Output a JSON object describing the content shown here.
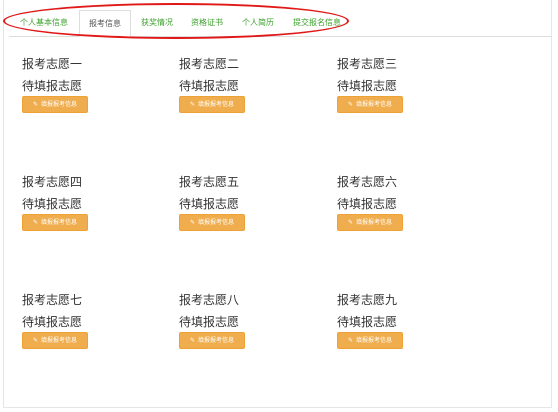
{
  "tabs": [
    {
      "label": "个人基本信息",
      "active": false
    },
    {
      "label": "报考信息",
      "active": true
    },
    {
      "label": "获奖情况",
      "active": false
    },
    {
      "label": "资格证书",
      "active": false
    },
    {
      "label": "个人简历",
      "active": false
    },
    {
      "label": "提交报名信息",
      "active": false
    }
  ],
  "colors": {
    "accent_green": "#3aa12b",
    "button_warning": "#f0ad4e",
    "annotation_red": "#e01818"
  },
  "choices": [
    {
      "title": "报考志愿一",
      "status": "待填报志愿",
      "button_label": "填报报考信息",
      "button_icon": "edit-icon"
    },
    {
      "title": "报考志愿二",
      "status": "待填报志愿",
      "button_label": "填报报考信息",
      "button_icon": "edit-icon"
    },
    {
      "title": "报考志愿三",
      "status": "待填报志愿",
      "button_label": "填报报考信息",
      "button_icon": "edit-icon"
    },
    {
      "title": "报考志愿四",
      "status": "待填报志愿",
      "button_label": "填报报考信息",
      "button_icon": "edit-icon"
    },
    {
      "title": "报考志愿五",
      "status": "待填报志愿",
      "button_label": "填报报考信息",
      "button_icon": "edit-icon"
    },
    {
      "title": "报考志愿六",
      "status": "待填报志愿",
      "button_label": "填报报考信息",
      "button_icon": "edit-icon"
    },
    {
      "title": "报考志愿七",
      "status": "待填报志愿",
      "button_label": "填报报考信息",
      "button_icon": "edit-icon"
    },
    {
      "title": "报考志愿八",
      "status": "待填报志愿",
      "button_label": "填报报考信息",
      "button_icon": "edit-icon"
    },
    {
      "title": "报考志愿九",
      "status": "待填报志愿",
      "button_label": "填报报考信息",
      "button_icon": "edit-icon"
    }
  ]
}
